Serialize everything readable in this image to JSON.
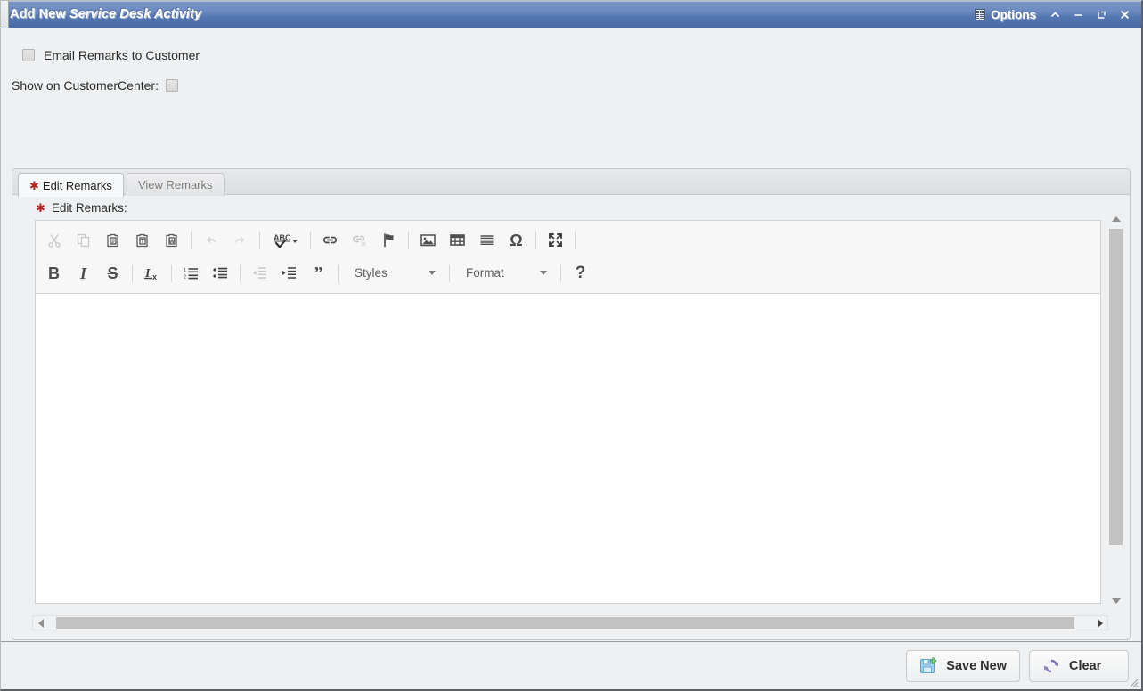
{
  "window": {
    "title_prefix": "Add New",
    "title_emphasis": "Service Desk Activity",
    "options_label": "Options",
    "controls": {
      "collapse": "collapse-caret",
      "minimize": "minimize-dash",
      "restore": "restore-square",
      "close": "close-x"
    }
  },
  "form": {
    "email_remarks": {
      "label": "Email Remarks to Customer",
      "checked": false
    },
    "show_on_customercenter": {
      "label": "Show on CustomerCenter:",
      "checked": false
    }
  },
  "tabs": [
    {
      "label": "Edit Remarks",
      "required": true,
      "active": true
    },
    {
      "label": "View Remarks",
      "required": false,
      "active": false
    }
  ],
  "field": {
    "label": "Edit Remarks:",
    "required_marker": "✱",
    "value": ""
  },
  "editor": {
    "toolbar_row1": [
      {
        "name": "cut",
        "title": "Cut",
        "disabled": true
      },
      {
        "name": "copy",
        "title": "Copy",
        "disabled": true
      },
      {
        "name": "paste",
        "title": "Paste",
        "disabled": false
      },
      {
        "name": "paste-text",
        "title": "Paste as plain text",
        "disabled": false
      },
      {
        "name": "paste-word",
        "title": "Paste from Word",
        "disabled": false
      },
      {
        "name": "separator",
        "title": "",
        "disabled": false
      },
      {
        "name": "undo",
        "title": "Undo",
        "disabled": true
      },
      {
        "name": "redo",
        "title": "Redo",
        "disabled": true
      },
      {
        "name": "separator",
        "title": "",
        "disabled": false
      },
      {
        "name": "spellcheck",
        "title": "Spell Check As You Type",
        "disabled": false
      },
      {
        "name": "separator",
        "title": "",
        "disabled": false
      },
      {
        "name": "link",
        "title": "Link",
        "disabled": false
      },
      {
        "name": "unlink",
        "title": "Unlink",
        "disabled": true
      },
      {
        "name": "anchor",
        "title": "Anchor",
        "disabled": false
      },
      {
        "name": "separator",
        "title": "",
        "disabled": false
      },
      {
        "name": "image",
        "title": "Image",
        "disabled": false
      },
      {
        "name": "table",
        "title": "Table",
        "disabled": false
      },
      {
        "name": "horizontal-rule",
        "title": "Horizontal Line",
        "disabled": false
      },
      {
        "name": "special-char",
        "title": "Insert Special Character",
        "disabled": false
      },
      {
        "name": "separator",
        "title": "",
        "disabled": false
      },
      {
        "name": "maximize",
        "title": "Maximize",
        "disabled": false
      }
    ],
    "toolbar_row2": [
      {
        "name": "bold",
        "title": "Bold",
        "disabled": false
      },
      {
        "name": "italic",
        "title": "Italic",
        "disabled": false
      },
      {
        "name": "strikethrough",
        "title": "Strikethrough",
        "disabled": false
      },
      {
        "name": "separator",
        "title": "",
        "disabled": false
      },
      {
        "name": "remove-format",
        "title": "Remove Format",
        "disabled": false
      },
      {
        "name": "separator",
        "title": "",
        "disabled": false
      },
      {
        "name": "numbered-list",
        "title": "Insert/Remove Numbered List",
        "disabled": false
      },
      {
        "name": "bulleted-list",
        "title": "Insert/Remove Bulleted List",
        "disabled": false
      },
      {
        "name": "separator",
        "title": "",
        "disabled": false
      },
      {
        "name": "outdent",
        "title": "Decrease Indent",
        "disabled": true
      },
      {
        "name": "indent",
        "title": "Increase Indent",
        "disabled": false
      },
      {
        "name": "blockquote",
        "title": "Block Quote",
        "disabled": false
      },
      {
        "name": "separator",
        "title": "",
        "disabled": false
      }
    ],
    "styles_dropdown": {
      "label": "Styles",
      "value": "Styles"
    },
    "format_dropdown": {
      "label": "Format",
      "value": "Format"
    },
    "about_button": {
      "label": "?",
      "title": "About CKEditor"
    },
    "content": ""
  },
  "scrollbars": {
    "vertical": {
      "up": "▲",
      "down": "▼"
    },
    "horizontal": {
      "left": "◀",
      "right": "▶"
    }
  },
  "footer": {
    "buttons": [
      {
        "label": "Save New",
        "icon": "save-new-icon"
      },
      {
        "label": "Clear",
        "icon": "clear-refresh-icon"
      }
    ]
  },
  "colors": {
    "titlebar_top": "#7e99c8",
    "titlebar_bottom": "#4a6aa6",
    "required_asterisk": "#b42323",
    "body_background": "#eef0f2",
    "editor_background": "#ffffff",
    "scroll_thumb": "#c2c2c2",
    "save_icon": "#6fb5e0",
    "save_badge": "#5fbf5f",
    "clear_icon": "#8f7fc0"
  }
}
